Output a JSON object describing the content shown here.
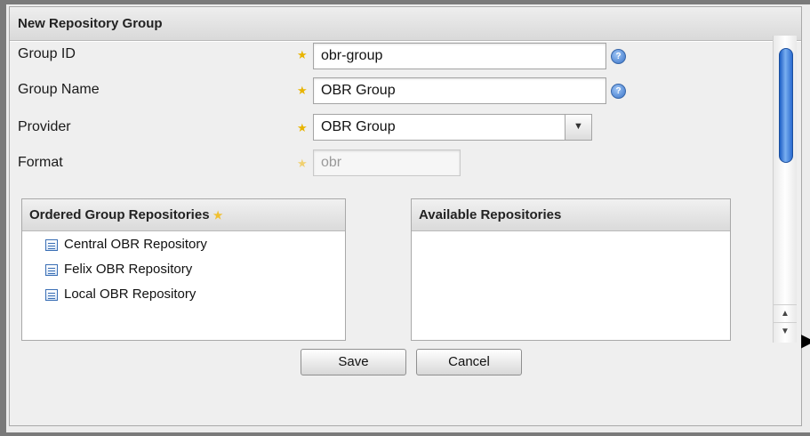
{
  "dialog": {
    "title": "New Repository Group"
  },
  "form": {
    "group_id": {
      "label": "Group ID",
      "value": "obr-group"
    },
    "group_name": {
      "label": "Group Name",
      "value": "OBR Group"
    },
    "provider": {
      "label": "Provider",
      "value": "OBR Group"
    },
    "format": {
      "label": "Format",
      "value": "obr"
    }
  },
  "ordered_repos": {
    "title": "Ordered Group Repositories",
    "items": [
      {
        "label": "Central OBR Repository"
      },
      {
        "label": "Felix OBR Repository"
      },
      {
        "label": "Local OBR Repository"
      }
    ]
  },
  "available_repos": {
    "title": "Available Repositories",
    "items": []
  },
  "buttons": {
    "save": "Save",
    "cancel": "Cancel"
  },
  "icons": {
    "required": "star-icon",
    "help": "help-icon",
    "repo": "repository-icon",
    "dropdown": "chevron-down-icon"
  },
  "colors": {
    "required_star": "#e8b400",
    "help_icon": "#3a74c9",
    "scroll_thumb": "#2a6bd0"
  }
}
